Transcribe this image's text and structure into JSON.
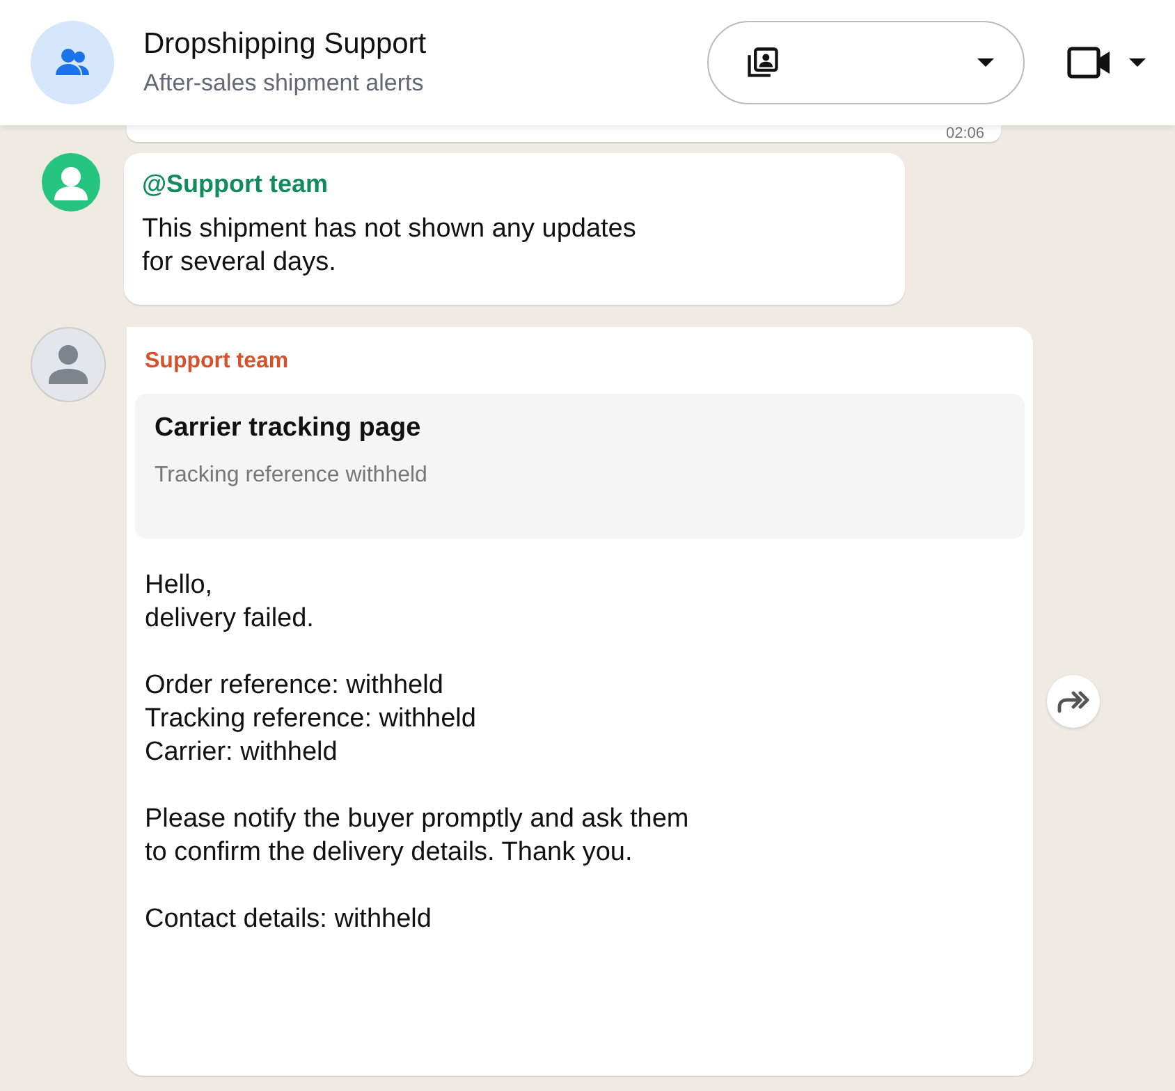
{
  "header": {
    "title": "Dropshipping Support",
    "subtitle": "After-sales shipment alerts"
  },
  "previous_message": {
    "time": "02:06"
  },
  "messages": [
    {
      "kind": "text",
      "sender": "@Support team",
      "color": "#128c5e",
      "paragraphs": [
        [
          "This shipment has not shown any updates",
          "for several days."
        ]
      ]
    },
    {
      "kind": "card",
      "sender": "Support team",
      "color": "#d4532c",
      "card": {
        "title": "Carrier tracking page",
        "subtitle": "Tracking reference withheld"
      },
      "paragraphs": [
        [
          "Hello,",
          "delivery failed."
        ],
        [
          "Order reference: withheld",
          "Tracking reference: withheld",
          "Carrier: withheld"
        ],
        [
          "Please notify the buyer promptly and ask them",
          "to confirm the delivery details. Thank you."
        ],
        [
          "Contact details: withheld"
        ]
      ],
      "forward": true
    }
  ]
}
